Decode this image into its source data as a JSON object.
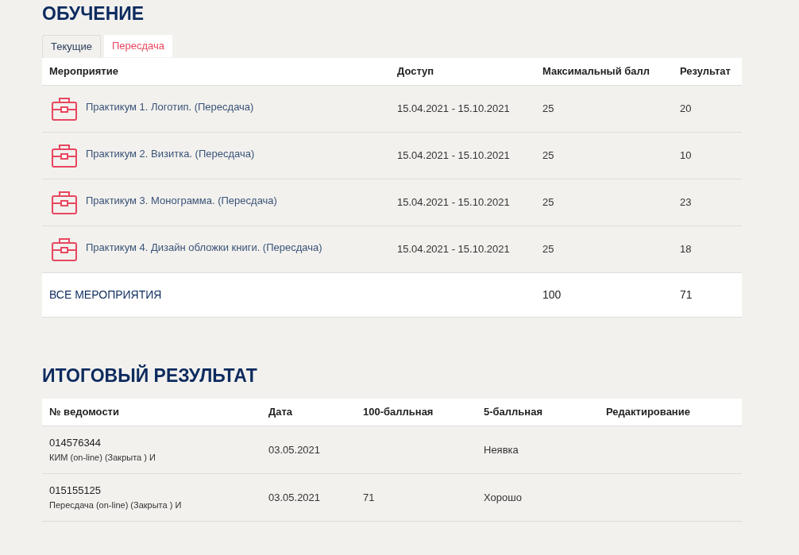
{
  "learning": {
    "title": "ОБУЧЕНИЕ",
    "tabs": [
      {
        "label": "Текущие",
        "selected": false
      },
      {
        "label": "Пересдача",
        "selected": true
      }
    ],
    "table": {
      "columns": [
        "Мероприятие",
        "Доступ",
        "Максимальный балл",
        "Результат"
      ],
      "rows": [
        {
          "event": "Практикум 1. Логотип. (Пересдача)",
          "access": "15.04.2021 - 15.10.2021",
          "max_score": "25",
          "result": "20"
        },
        {
          "event": "Практикум 2. Визитка. (Пересдача)",
          "access": "15.04.2021 - 15.10.2021",
          "max_score": "25",
          "result": "10"
        },
        {
          "event": "Практикум 3. Монограмма. (Пересдача)",
          "access": "15.04.2021 - 15.10.2021",
          "max_score": "25",
          "result": "23"
        },
        {
          "event": "Практикум 4. Дизайн обложки книги. (Пересдача)",
          "access": "15.04.2021 - 15.10.2021",
          "max_score": "25",
          "result": "18"
        }
      ],
      "total": {
        "label": "ВСЕ МЕРОПРИЯТИЯ",
        "max_score": "100",
        "result": "71"
      }
    }
  },
  "final": {
    "title": "ИТОГОВЫЙ РЕЗУЛЬТАТ",
    "table": {
      "columns": [
        "№ ведомости",
        "Дата",
        "100-балльная",
        "5-балльная",
        "Редактирование"
      ],
      "rows": [
        {
          "number": "014576344",
          "type": "КИМ (on-line) (Закрыта ) И",
          "date": "03.05.2021",
          "score_100": "",
          "score_5": "Неявка"
        },
        {
          "number": "015155125",
          "type": "Пересдача (on-line) (Закрыта ) И",
          "date": "03.05.2021",
          "score_100": "71",
          "score_5": "Хорошо"
        }
      ]
    }
  }
}
